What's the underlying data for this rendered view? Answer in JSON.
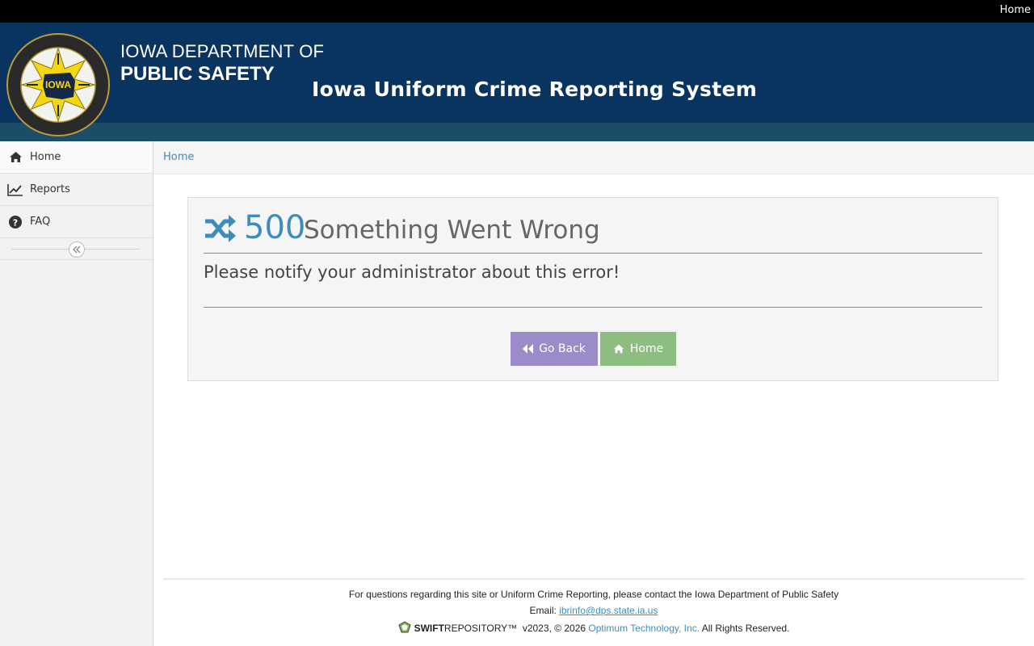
{
  "topbar": {
    "home_link": "Home"
  },
  "banner": {
    "seal_text": "DEPARTMENT OF PUBLIC SAFETY · PROTECTION ALL WAYS",
    "seal_center": "IOWA",
    "dept_line1": "IOWA DEPARTMENT OF",
    "dept_line2": "PUBLIC SAFETY",
    "system_title": "Iowa Uniform Crime Reporting System"
  },
  "sidebar": {
    "items": [
      {
        "label": "Home",
        "icon": "home-icon"
      },
      {
        "label": "Reports",
        "icon": "line-chart-icon"
      },
      {
        "label": "FAQ",
        "icon": "question-circle-icon"
      }
    ]
  },
  "breadcrumb": {
    "home": "Home"
  },
  "error": {
    "code": "500",
    "title": "Something Went Wrong",
    "message": "Please notify your administrator about this error!",
    "back_label": "Go Back",
    "home_label": "Home"
  },
  "footer": {
    "contact_text": "For questions regarding this site or Uniform Crime Reporting, please contact the Iowa Department of Public Safety",
    "email_label": "Email:",
    "email": "ibrinfo@dps.state.ia.us",
    "brand_bold": "SWIFT",
    "brand_rest": "REPOSITORY™",
    "version_text": "v2023, © 2026",
    "company": "Optimum Technology, Inc.",
    "rights": "All Rights Reserved."
  },
  "colors": {
    "banner": "#0a3460",
    "accent": "#3c8dbc",
    "back_button": "#9b8bc8",
    "home_button": "#8ebd82"
  }
}
